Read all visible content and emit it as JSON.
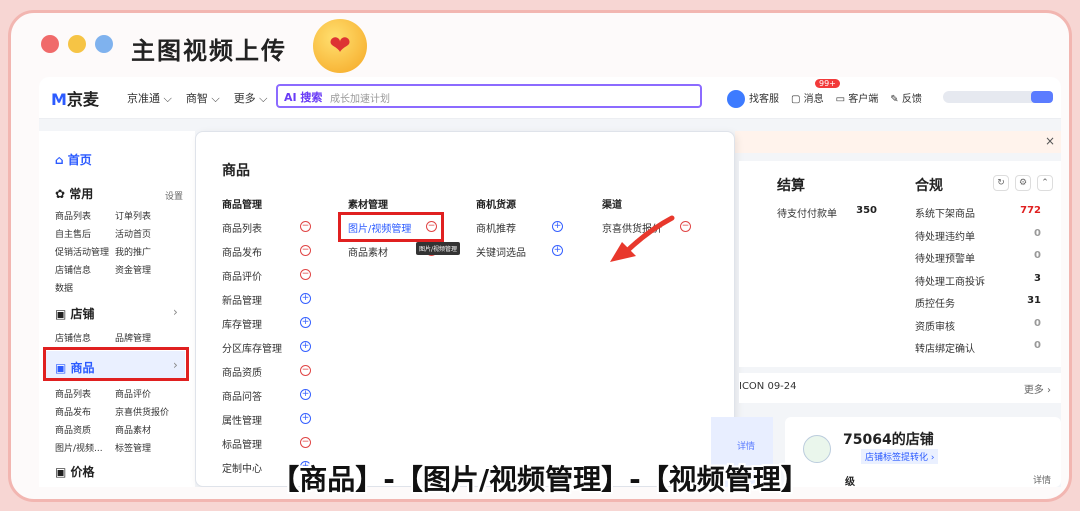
{
  "frame": {
    "title": "主图视频上传",
    "dots": [
      "#f06a6a",
      "#f6c445",
      "#7fb2ee"
    ],
    "emoji_name": "kiss-face-emoji",
    "emoji_glyph": "❤"
  },
  "topbar": {
    "logo_mark": "M",
    "logo_text": "京麦",
    "nav": [
      "京准通 ⌵",
      "商智 ⌵",
      "更多 ⌵"
    ],
    "search_ai": "AI 搜索",
    "search_placeholder": "成长加速计划",
    "tools": {
      "service": "找客服",
      "messages": "消息",
      "client": "客户端",
      "feedback": "反馈"
    },
    "msg_badge": "99+"
  },
  "sidebar": {
    "home": "首页",
    "common": "常用",
    "common_setting": "设置",
    "common_items": [
      "商品列表",
      "订单列表",
      "自主售后",
      "活动首页",
      "促销活动管理",
      "我的推广",
      "店铺信息",
      "资金管理",
      "数据"
    ],
    "store": "店铺",
    "store_items": [
      "店铺信息",
      "品牌管理"
    ],
    "product": "商品",
    "product_items": [
      "商品列表",
      "商品评价",
      "商品发布",
      "京喜供货报价",
      "商品资质",
      "商品素材",
      "图片/视频...",
      "标签管理"
    ],
    "price": "价格"
  },
  "panel": {
    "title": "商品",
    "col1_head": "商品管理",
    "col1": [
      "商品列表",
      "商品发布",
      "商品评价",
      "新品管理",
      "库存管理",
      "分区库存管理",
      "商品资质",
      "商品问答",
      "属性管理",
      "标品管理",
      "定制中心"
    ],
    "col1_icons": [
      "m",
      "m",
      "m",
      "p",
      "p",
      "p",
      "m",
      "p",
      "p",
      "m",
      "p"
    ],
    "col2_head": "素材管理",
    "col2": [
      "图片/视频管理",
      "商品素材"
    ],
    "col2_icons": [
      "m",
      "m"
    ],
    "col3_head": "商机货源",
    "col3": [
      "商机推荐",
      "关键词选品"
    ],
    "col3_icons": [
      "p",
      "p"
    ],
    "col4_head": "渠道",
    "col4": [
      "京喜供货报价"
    ],
    "col4_icons": [
      "m"
    ],
    "tooltip": "图片/视频管理"
  },
  "settle": {
    "title": "结算",
    "label": "待支付付款单",
    "value": "350"
  },
  "compliance": {
    "title": "合规",
    "rows": [
      {
        "label": "系统下架商品",
        "value": "772",
        "color": "#e02020"
      },
      {
        "label": "待处理违约单",
        "value": "0",
        "color": "#999"
      },
      {
        "label": "待处理预警单",
        "value": "0",
        "color": "#999"
      },
      {
        "label": "待处理工商投诉",
        "value": "3",
        "color": "#222"
      },
      {
        "label": "质控任务",
        "value": "31",
        "color": "#222"
      },
      {
        "label": "资质审核",
        "value": "0",
        "color": "#999"
      },
      {
        "label": "转店绑定确认",
        "value": "0",
        "color": "#999"
      }
    ]
  },
  "strip": {
    "left": "ICON 09-24",
    "right": "更多 ›"
  },
  "card1": {
    "label": "详情"
  },
  "store_card": {
    "name": "75064的店铺",
    "tag": "店铺标签提转化 ›",
    "bottom_left": "级",
    "bottom_right": "详情"
  },
  "notice_close": "×",
  "caption": "【商品】-【图片/视频管理】-【视频管理】"
}
